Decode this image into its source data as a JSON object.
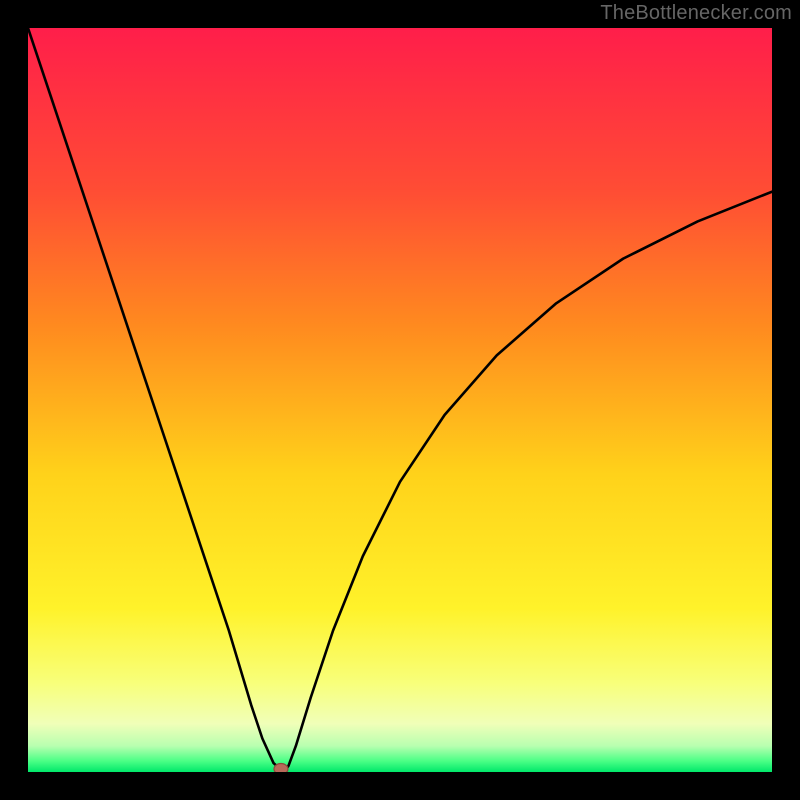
{
  "watermark": "TheBottlenecker.com",
  "colors": {
    "bg": "#000000",
    "curve": "#000000",
    "marker_fill": "#b86a5a",
    "marker_stroke": "#8e4a3c",
    "gradient_stops": [
      {
        "offset": 0.0,
        "color": "#ff1e4a"
      },
      {
        "offset": 0.22,
        "color": "#ff4d34"
      },
      {
        "offset": 0.4,
        "color": "#ff8a1f"
      },
      {
        "offset": 0.6,
        "color": "#ffd21a"
      },
      {
        "offset": 0.78,
        "color": "#fff22a"
      },
      {
        "offset": 0.88,
        "color": "#f8ff7a"
      },
      {
        "offset": 0.935,
        "color": "#f0ffb8"
      },
      {
        "offset": 0.965,
        "color": "#b8ffb0"
      },
      {
        "offset": 0.985,
        "color": "#4cff86"
      },
      {
        "offset": 1.0,
        "color": "#00e86a"
      }
    ]
  },
  "chart_data": {
    "type": "line",
    "title": "",
    "xlabel": "",
    "ylabel": "",
    "xlim": [
      0,
      100
    ],
    "ylim": [
      0,
      100
    ],
    "grid": false,
    "legend": false,
    "series": [
      {
        "name": "bottleneck-curve",
        "x": [
          0,
          3,
          6,
          9,
          12,
          15,
          18,
          21,
          24,
          27,
          30,
          31.5,
          33,
          34,
          34.5,
          35,
          36,
          38,
          41,
          45,
          50,
          56,
          63,
          71,
          80,
          90,
          100
        ],
        "y": [
          100,
          91,
          82,
          73,
          64,
          55,
          46,
          37,
          28,
          19,
          9,
          4.5,
          1.2,
          0.3,
          0.1,
          0.8,
          3.5,
          10,
          19,
          29,
          39,
          48,
          56,
          63,
          69,
          74,
          78
        ]
      }
    ],
    "marker": {
      "x": 34,
      "y": 0.4
    }
  }
}
